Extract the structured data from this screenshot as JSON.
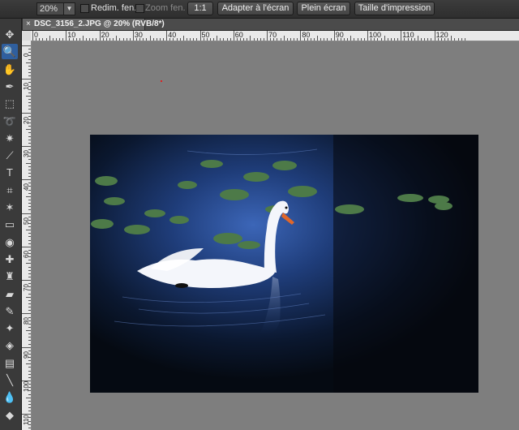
{
  "options_bar": {
    "zoom_value": "20%",
    "resize_windows_label": "Redim. fen.",
    "zoom_windows_label": "Zoom fen.",
    "btn_actual_pixels": "1:1",
    "btn_fit_screen": "Adapter à l'écran",
    "btn_full_screen": "Plein écran",
    "btn_print_size": "Taille d'impression"
  },
  "document_tab": {
    "close_glyph": "×",
    "title": "DSC_3156_2.JPG @ 20% (RVB/8*)"
  },
  "ruler": {
    "top_labels": [
      "0",
      "10",
      "20",
      "30",
      "40",
      "50",
      "60",
      "70",
      "80",
      "90",
      "100",
      "110",
      "120"
    ],
    "left_labels": [
      "0",
      "10",
      "20",
      "30",
      "40",
      "50",
      "60",
      "70",
      "80",
      "90",
      "100",
      "110"
    ]
  },
  "tools": [
    {
      "name": "move-tool-icon",
      "glyph": "✥"
    },
    {
      "name": "zoom-tool-icon",
      "glyph": "🔍"
    },
    {
      "name": "hand-tool-icon",
      "glyph": "✋"
    },
    {
      "name": "eyedropper-tool-icon",
      "glyph": "✒"
    },
    {
      "name": "marquee-tool-icon",
      "glyph": "⬚"
    },
    {
      "name": "lasso-tool-icon",
      "glyph": "➰"
    },
    {
      "name": "magic-wand-tool-icon",
      "glyph": "✷"
    },
    {
      "name": "quick-selection-tool-icon",
      "glyph": "⟋"
    },
    {
      "name": "type-tool-icon",
      "glyph": "T"
    },
    {
      "name": "crop-tool-icon",
      "glyph": "⌗"
    },
    {
      "name": "cookie-cutter-tool-icon",
      "glyph": "✶"
    },
    {
      "name": "straighten-tool-icon",
      "glyph": "▭"
    },
    {
      "name": "red-eye-tool-icon",
      "glyph": "◉"
    },
    {
      "name": "healing-brush-tool-icon",
      "glyph": "✚"
    },
    {
      "name": "clone-stamp-tool-icon",
      "glyph": "♜"
    },
    {
      "name": "eraser-tool-icon",
      "glyph": "▰"
    },
    {
      "name": "brush-tool-icon",
      "glyph": "✎"
    },
    {
      "name": "smart-brush-tool-icon",
      "glyph": "✦"
    },
    {
      "name": "paint-bucket-tool-icon",
      "glyph": "◈"
    },
    {
      "name": "gradient-tool-icon",
      "glyph": "▤"
    },
    {
      "name": "shape-tool-icon",
      "glyph": "╲"
    },
    {
      "name": "blur-tool-icon",
      "glyph": "💧"
    },
    {
      "name": "sponge-tool-icon",
      "glyph": "◆"
    }
  ],
  "active_tool_index": 1,
  "colors": {
    "canvas_gray": "#7e7e7e",
    "active_tool": "#2f5f9e",
    "water_dark": "#06101c",
    "water_blue": "#2a4f9a",
    "lily_green": "#4d7a48",
    "swan_white": "#f4f6fb",
    "beak_orange": "#e0672a"
  }
}
